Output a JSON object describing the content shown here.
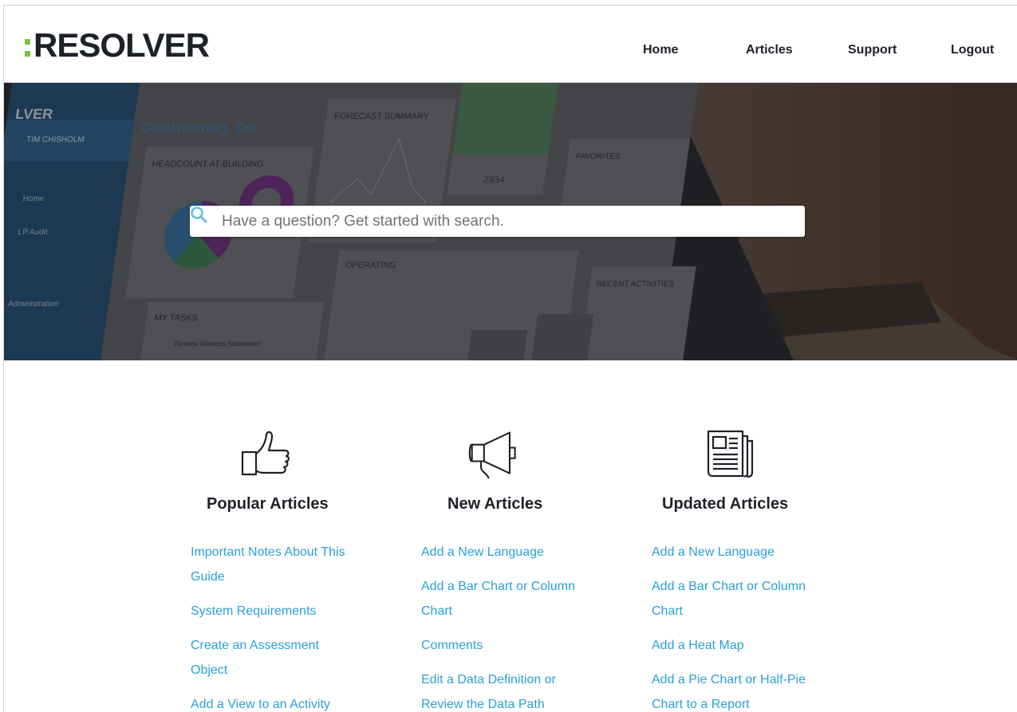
{
  "brand": {
    "name": "RESOLVER",
    "accent": "#7cc242"
  },
  "nav": [
    {
      "label": "Home"
    },
    {
      "label": "Articles"
    },
    {
      "label": "Support"
    },
    {
      "label": "Logout"
    }
  ],
  "hero": {
    "screen": {
      "sidebar_brand": "LVER",
      "user": "TIM CHISHOLM",
      "nav_items": [
        "Home",
        "LP Audit",
        "Administration"
      ],
      "greeting": "Good morning, Tim",
      "widget_headcount": "HEADCOUNT AT BUILDING",
      "widget_forecast": "FORECAST SUMMARY",
      "widget_operating": "OPERATING",
      "widget_tasks": "MY TASKS",
      "task_item": "Review Witness Statement",
      "widget_favorites": "FAVORITES",
      "widget_recent": "RECENT ACTIVITIES",
      "stat_value": "2934"
    }
  },
  "search": {
    "placeholder": "Have a question? Get started with search.",
    "value": ""
  },
  "sections": [
    {
      "title": "Popular Articles",
      "icon": "thumbs-up-icon",
      "links": [
        "Important Notes About This Guide",
        "System Requirements",
        "Create an Assessment Object",
        "Add a View to an Activity"
      ]
    },
    {
      "title": "New Articles",
      "icon": "megaphone-icon",
      "links": [
        "Add a New Language",
        "Add a Bar Chart or Column Chart",
        "Comments",
        "Edit a Data Definition or Review the Data Path"
      ]
    },
    {
      "title": "Updated Articles",
      "icon": "newspaper-icon",
      "links": [
        "Add a New Language",
        "Add a Bar Chart or Column Chart",
        "Add a Heat Map",
        "Add a Pie Chart or Half-Pie Chart to a Report"
      ]
    }
  ]
}
